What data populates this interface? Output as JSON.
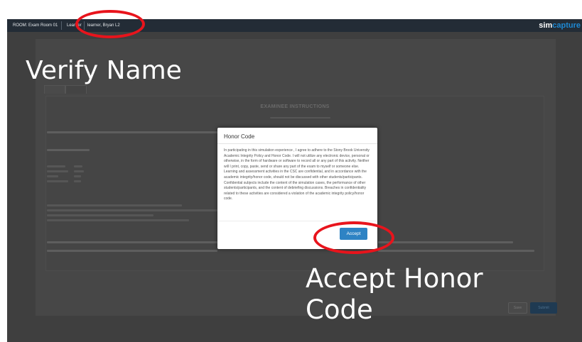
{
  "topbar": {
    "room": "ROOM: Exam Room 01",
    "role": "Learner",
    "user": "learner, Bryan L2",
    "logo_part1": "sim",
    "logo_part2": "capture"
  },
  "annotations": {
    "verify_name": "Verify Name",
    "accept_line1": "Accept Honor",
    "accept_line2": "Code"
  },
  "background": {
    "instructions_heading": "EXAMINEE INSTRUCTIONS"
  },
  "modal": {
    "title": "Honor Code",
    "body": "In participating in this simulation experience , I agree to adhere to the Stony Brook University Academic Integrity Policy and Honor Code. I will not utilize any electronic device, personal or otherwise, in the form of hardware or software to record all or any part of this activity. Neither will I print, copy, paste, send or share any part of the exam to myself or someone else. Learning and assessment activities in the CSC are confidential, and in accordance with the academic integrity/honor code, should not be discussed with other students/participants. Confidential subjects include the content of the simulation cases, the performance of other students/participants, and the content of debriefing discussions. Breaches in confidentiality related to these activities are considered a violation of the academic integrity policy/honor code.",
    "accept_label": "Accept"
  },
  "buttons": {
    "save_label": "Save",
    "submit_label": "Submit"
  },
  "colors": {
    "annotation_circle": "#e8141c",
    "accent": "#2e83c4",
    "topbar": "#232c36"
  }
}
